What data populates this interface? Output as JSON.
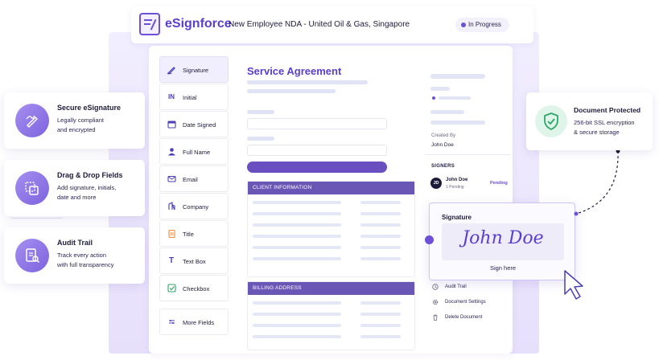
{
  "header": {
    "brand": "eSignforce",
    "document_title": "New Employee NDA - United Oil & Gas, Singapore",
    "status": "In Progress"
  },
  "fields": [
    {
      "label": "Signature",
      "icon": "pen-icon"
    },
    {
      "label": "Initial",
      "icon": "initials-icon",
      "glyph": "IN"
    },
    {
      "label": "Date Signed",
      "icon": "calendar-icon"
    },
    {
      "label": "Full Name",
      "icon": "person-icon"
    },
    {
      "label": "Email",
      "icon": "mail-icon"
    },
    {
      "label": "Company",
      "icon": "building-icon"
    },
    {
      "label": "Title",
      "icon": "clipboard-icon"
    },
    {
      "label": "Text Box",
      "icon": "text-icon",
      "glyph": "T"
    },
    {
      "label": "Checkbox",
      "icon": "checkbox-icon"
    },
    {
      "label": "More Fields",
      "icon": "sliders-icon"
    }
  ],
  "agreement": {
    "title": "Service Agreement",
    "sections": [
      "CLIENT INFORMATION",
      "BILLING ADDRESS"
    ]
  },
  "info": {
    "created_by_label": "Created By",
    "created_by": "John Doe",
    "signers_label": "SIGNERS",
    "signer": {
      "initials": "JD",
      "name": "John Doe",
      "sub": "1 Pending",
      "status": "Pending"
    },
    "menu": [
      {
        "label": "Audit Trail",
        "icon": "clock-icon"
      },
      {
        "label": "Document Settings",
        "icon": "gear-icon"
      },
      {
        "label": "Delete Document",
        "icon": "trash-icon"
      }
    ]
  },
  "signature_popover": {
    "title": "Signature",
    "signature_text": "John Doe",
    "action": "Sign here"
  },
  "features": [
    {
      "title": "Secure eSignature",
      "line1": "Legally compliant",
      "line2": "and encrypted",
      "icon": "signature-pen-icon"
    },
    {
      "title": "Drag & Drop Fields",
      "line1": "Add signature, initials,",
      "line2": "date and more",
      "icon": "drag-drop-icon"
    },
    {
      "title": "Audit Trail",
      "line1": "Track every action",
      "line2": "with full transparency",
      "icon": "audit-document-icon"
    }
  ],
  "protected": {
    "title": "Document Protected",
    "line1": "256-bit SSL encryption",
    "line2": "& secure storage",
    "icon": "shield-check-icon"
  },
  "colors": {
    "accent": "#6d4fd8",
    "section_header": "#6a56b4",
    "success": "#2fa56a"
  }
}
